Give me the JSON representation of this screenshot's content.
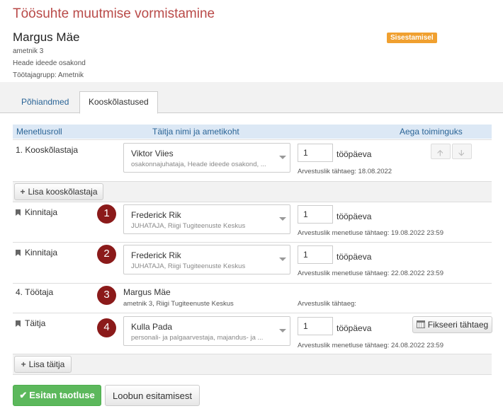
{
  "header": {
    "title": "Töösuhte muutmise vormistamine",
    "person_name": "Margus Mäe",
    "position": "ametnik 3",
    "department": "Heade ideede osakond",
    "group": "Töötajagrupp: Ametnik",
    "status": "Sisestamisel"
  },
  "tabs": [
    {
      "label": "Põhiandmed"
    },
    {
      "label": "Kooskõlastused"
    }
  ],
  "table": {
    "col_role": "Menetlusroll",
    "col_name": "Täitja nimi ja ametikoht",
    "col_time": "Aega toiminguks"
  },
  "rows": [
    {
      "role": "1. Kooskõlastaja",
      "name": "Viktor Viies",
      "detail": "osakonnajuhataja, Heade ideede osakond, ...",
      "days": "1",
      "unit": "tööpäeva",
      "deadline": "Arvestuslik tähtaeg: 18.08.2022"
    },
    {
      "role": "Kinnitaja",
      "badge": "1",
      "name": "Frederick Rik",
      "detail": "JUHATAJA, Riigi Tugiteenuste Keskus",
      "days": "1",
      "unit": "tööpäeva",
      "deadline": "Arvestuslik menetluse tähtaeg: 19.08.2022 23:59"
    },
    {
      "role": "Kinnitaja",
      "badge": "2",
      "name": "Frederick Rik",
      "detail": "JUHATAJA, Riigi Tugiteenuste Keskus",
      "days": "1",
      "unit": "tööpäeva",
      "deadline": "Arvestuslik menetluse tähtaeg: 22.08.2022 23:59"
    },
    {
      "role": "4. Töötaja",
      "badge": "3",
      "name": "Margus Mäe",
      "detail": "ametnik 3, Riigi Tugiteenuste Keskus",
      "deadline": "Arvestuslik tähtaeg:"
    },
    {
      "role": "Täitja",
      "badge": "4",
      "name": "Kulla Pada",
      "detail": "personali- ja palgaarvestaja, majandus- ja ...",
      "days": "1",
      "unit": "tööpäeva",
      "deadline": "Arvestuslik menetluse tähtaeg: 24.08.2022 23:59"
    }
  ],
  "buttons": {
    "add_approver": "Lisa kooskõlastaja",
    "add_executor": "Lisa täitja",
    "fix_deadline": "Fikseeri tähtaeg",
    "submit": "Esitan taotluse",
    "cancel": "Loobun esitamisest"
  },
  "icons": {
    "up": "arrow-up-icon",
    "down": "arrow-down-icon",
    "bookmark": "bookmark-icon",
    "calendar": "calendar-icon",
    "check": "check-icon",
    "plus": "plus-icon"
  },
  "colors": {
    "title": "#b94a48",
    "status_badge": "#f0a030",
    "number_badge": "#8b1a1a",
    "submit": "#5cb85c",
    "table_header": "#dce8f5"
  }
}
